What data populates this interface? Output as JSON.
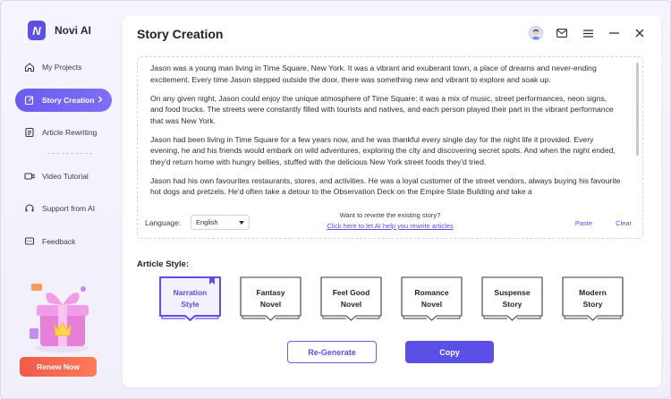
{
  "app": {
    "name": "Novi AI",
    "logo_letter": "N"
  },
  "sidebar": {
    "items": [
      {
        "label": "My Projects",
        "icon": "home-icon"
      },
      {
        "label": "Story Creation",
        "icon": "edit-icon",
        "active": true
      },
      {
        "label": "Article Rewriting",
        "icon": "document-icon"
      },
      {
        "label": "Video Tutorial",
        "icon": "video-icon"
      },
      {
        "label": "Support from AI",
        "icon": "headset-icon"
      },
      {
        "label": "Feedback",
        "icon": "chat-icon"
      }
    ],
    "promo_icon": "gift-box-icon",
    "renew_label": "Renew Now"
  },
  "header": {
    "title": "Story Creation",
    "icons": [
      "avatar",
      "mail-icon",
      "menu-icon",
      "minimize-icon",
      "close-icon"
    ]
  },
  "editor": {
    "paragraphs": [
      "Jason was a young man living in Time Square, New York. It was a vibrant and exuberant town, a place of dreams and never-ending excitement. Every time Jason stepped outside the door, there was something new and vibrant to explore and soak up.",
      "On any given night, Jason could enjoy the unique atmosphere of Time Square: it was a mix of music, street performances, neon signs, and food trucks. The streets were constantly filled with tourists and natives, and each person played their part in the vibrant performance that was New York.",
      "Jason had been living in Time Square for a few years now, and he was thankful every single day for the night life it provided. Every evening, he and his friends would embark on wild adventures, exploring the city and discovering secret spots. And when the night ended, they'd return home with hungry bellies, stuffed with the delicious New York street foods they'd tried.",
      "Jason had his own favourites restaurants, stores, and activities. He was a loyal customer of the street vendors, always buying his favourite hot dogs and pretzels. He'd often take a detour to the Observation Deck on the Empire State Building and take a"
    ],
    "language_label": "Language:",
    "language_value": "English",
    "rewrite_question": "Want to rewrite the existing story?",
    "rewrite_link": "Click here to let AI help you rewrite articles",
    "paste_label": "Paste",
    "clear_label": "Clear"
  },
  "article_style": {
    "label": "Article Style:",
    "options": [
      {
        "label": "Narration\nStyle",
        "selected": true
      },
      {
        "label": "Fantasy\nNovel"
      },
      {
        "label": "Feel Good\nNovel"
      },
      {
        "label": "Romance\nNovel"
      },
      {
        "label": "Suspense\nStory"
      },
      {
        "label": "Modern\nStory"
      }
    ]
  },
  "actions": {
    "regenerate_label": "Re-Generate",
    "copy_label": "Copy"
  },
  "colors": {
    "accent": "#5b4fe6",
    "renew": "#f05a4a",
    "text": "#1f1f2e"
  }
}
